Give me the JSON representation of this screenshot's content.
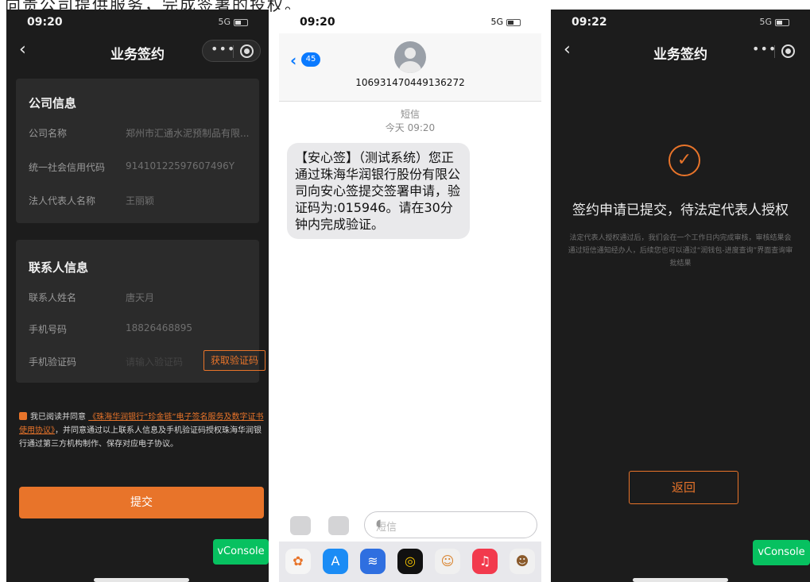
{
  "top_text": "向贵公司提供服务，完成签署的投权。",
  "screen1": {
    "status": {
      "time": "09:20",
      "network": "5G"
    },
    "nav": {
      "back": "‹",
      "title": "业务签约",
      "more": "•••"
    },
    "company": {
      "title": "公司信息",
      "rows": [
        {
          "label": "公司名称",
          "value": "郑州市汇通水泥预制品有限..."
        },
        {
          "label": "统一社会信用代码",
          "value": "91410122597607496Y"
        },
        {
          "label": "法人代表人名称",
          "value": "王丽颖"
        }
      ]
    },
    "contact": {
      "title": "联系人信息",
      "rows": [
        {
          "label": "联系人姓名",
          "value": "唐天月"
        },
        {
          "label": "手机号码",
          "value": "18826468895"
        },
        {
          "label": "手机验证码",
          "value": "请输入验证码"
        }
      ],
      "code_button": "获取验证码"
    },
    "agreement": {
      "prefix": "我已阅读并同意",
      "link": "《珠海华润银行“珍金链”电子签名服务及数字证书使用协议》",
      "suffix": "，并同意通过以上联系人信息及手机验证码授权珠海华润银行通过第三方机构制作、保存对应电子协议。"
    },
    "submit_label": "提交",
    "vconsole": "vConsole"
  },
  "screen2": {
    "status": {
      "time": "09:20",
      "network": "5G"
    },
    "badge": "45",
    "sender": "106931470449136272",
    "kind": "短信",
    "date": "今天 09:20",
    "message": "【安心签】（测试系统）您正通过珠海华润银行股份有限公司向安心签提交签署申请，验证码为:015946。请在30分钟内完成验证。",
    "input_placeholder": "短信",
    "dock_icons": [
      "photos-icon",
      "appstore-icon",
      "audio-icon",
      "fitness-icon",
      "memoji-icon",
      "music-icon",
      "animoji-icon"
    ]
  },
  "screen3": {
    "status": {
      "time": "09:22",
      "network": "5G"
    },
    "nav": {
      "back": "‹",
      "title": "业务签约",
      "more": "•••"
    },
    "result_title": "签约申请已提交，待法定代表人授权",
    "result_desc": "法定代表人授权通过后，我们会在一个工作日内完成审核，审核结果会通过短信通知经办人，后续您也可以通过“润钱包-进度查询”界面查询审批结果",
    "return_label": "返回",
    "vconsole": "vConsole"
  },
  "colors": {
    "accent": "#e8742a",
    "dark_bg": "#1c1c1c",
    "card_bg": "#2b2b2b",
    "link_blue": "#0a7aff",
    "vconsole_green": "#07c160"
  }
}
